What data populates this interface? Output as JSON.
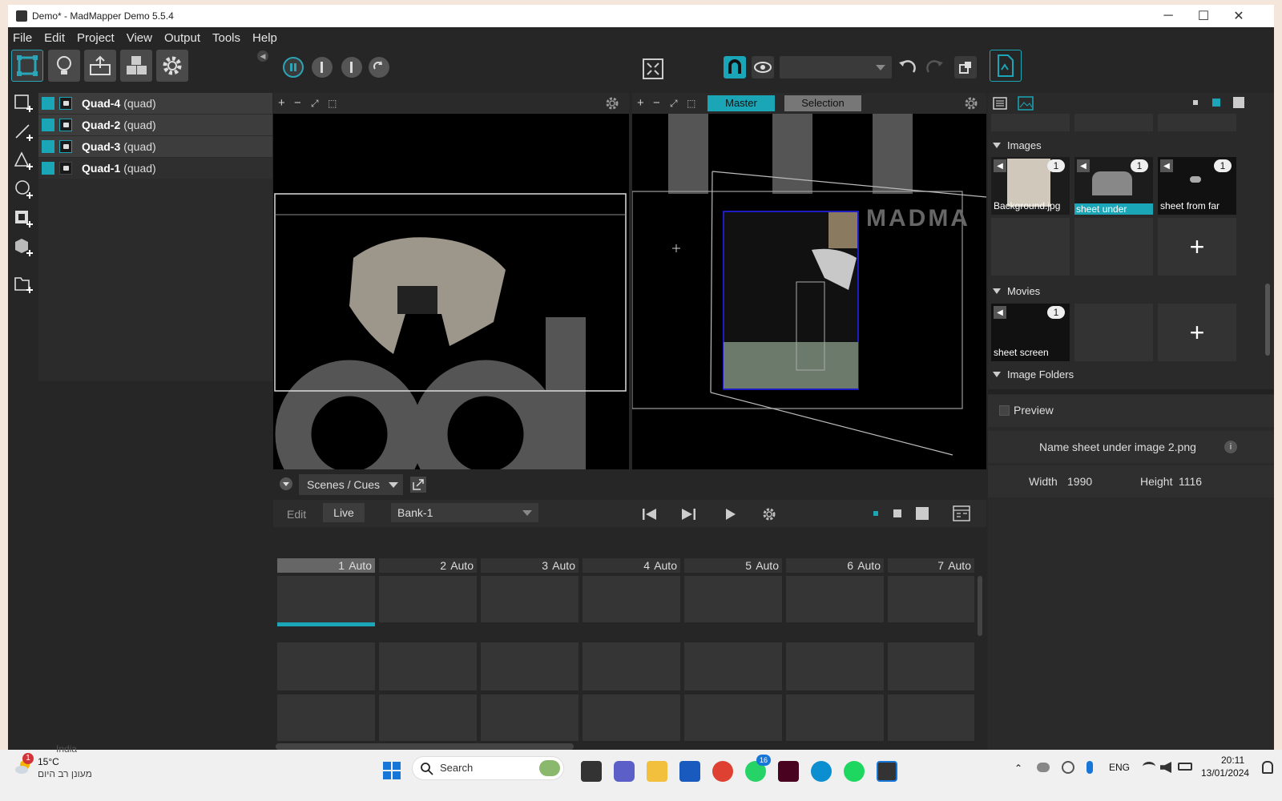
{
  "window": {
    "title": "Demo* - MadMapper Demo 5.5.4",
    "minimize": "─",
    "maximize": "☐",
    "close": "✕"
  },
  "menu": [
    "File",
    "Edit",
    "Project",
    "View",
    "Output",
    "Tools",
    "Help"
  ],
  "layers": [
    {
      "name": "Quad-4",
      "type": "(quad)"
    },
    {
      "name": "Quad-2",
      "type": "(quad)"
    },
    {
      "name": "Quad-3",
      "type": "(quad)"
    },
    {
      "name": "Quad-1",
      "type": "(quad)"
    }
  ],
  "output_view": {
    "tabs": [
      "Master",
      "Selection"
    ],
    "overlay_text": "MADMA"
  },
  "right_panel": {
    "sections": {
      "images": "Images",
      "movies": "Movies",
      "image_folders": "Image Folders"
    },
    "images": [
      {
        "label": "Background.jpg",
        "count": "1"
      },
      {
        "label": "sheet under",
        "count": "1"
      },
      {
        "label": "sheet from far",
        "count": "1"
      }
    ],
    "movies": [
      {
        "label": "sheet screen",
        "count": "1"
      }
    ],
    "add": "+",
    "preview_label": "Preview",
    "name_label": "Name",
    "name_value": "sheet under image 2.png",
    "info": "i",
    "width_label": "Width",
    "width_value": "1990",
    "height_label": "Height",
    "height_value": "1116"
  },
  "scenes": {
    "dropdown": "Scenes / Cues",
    "edit": "Edit",
    "live": "Live",
    "bank": "Bank-1",
    "cues": [
      {
        "n": "1",
        "mode": "Auto"
      },
      {
        "n": "2",
        "mode": "Auto"
      },
      {
        "n": "3",
        "mode": "Auto"
      },
      {
        "n": "4",
        "mode": "Auto"
      },
      {
        "n": "5",
        "mode": "Auto"
      },
      {
        "n": "6",
        "mode": "Auto"
      },
      {
        "n": "7",
        "mode": "Auto"
      }
    ]
  },
  "taskbar": {
    "weather_temp": "15°C",
    "weather_desc": "מעונן רב היום",
    "weather_badge": "1",
    "search": "Search",
    "whatsapp_badge": "16",
    "lang": "ENG",
    "time": "20:11",
    "date": "13/01/2024",
    "behind": "India"
  },
  "colors": {
    "accent": "#1ba6b8"
  }
}
